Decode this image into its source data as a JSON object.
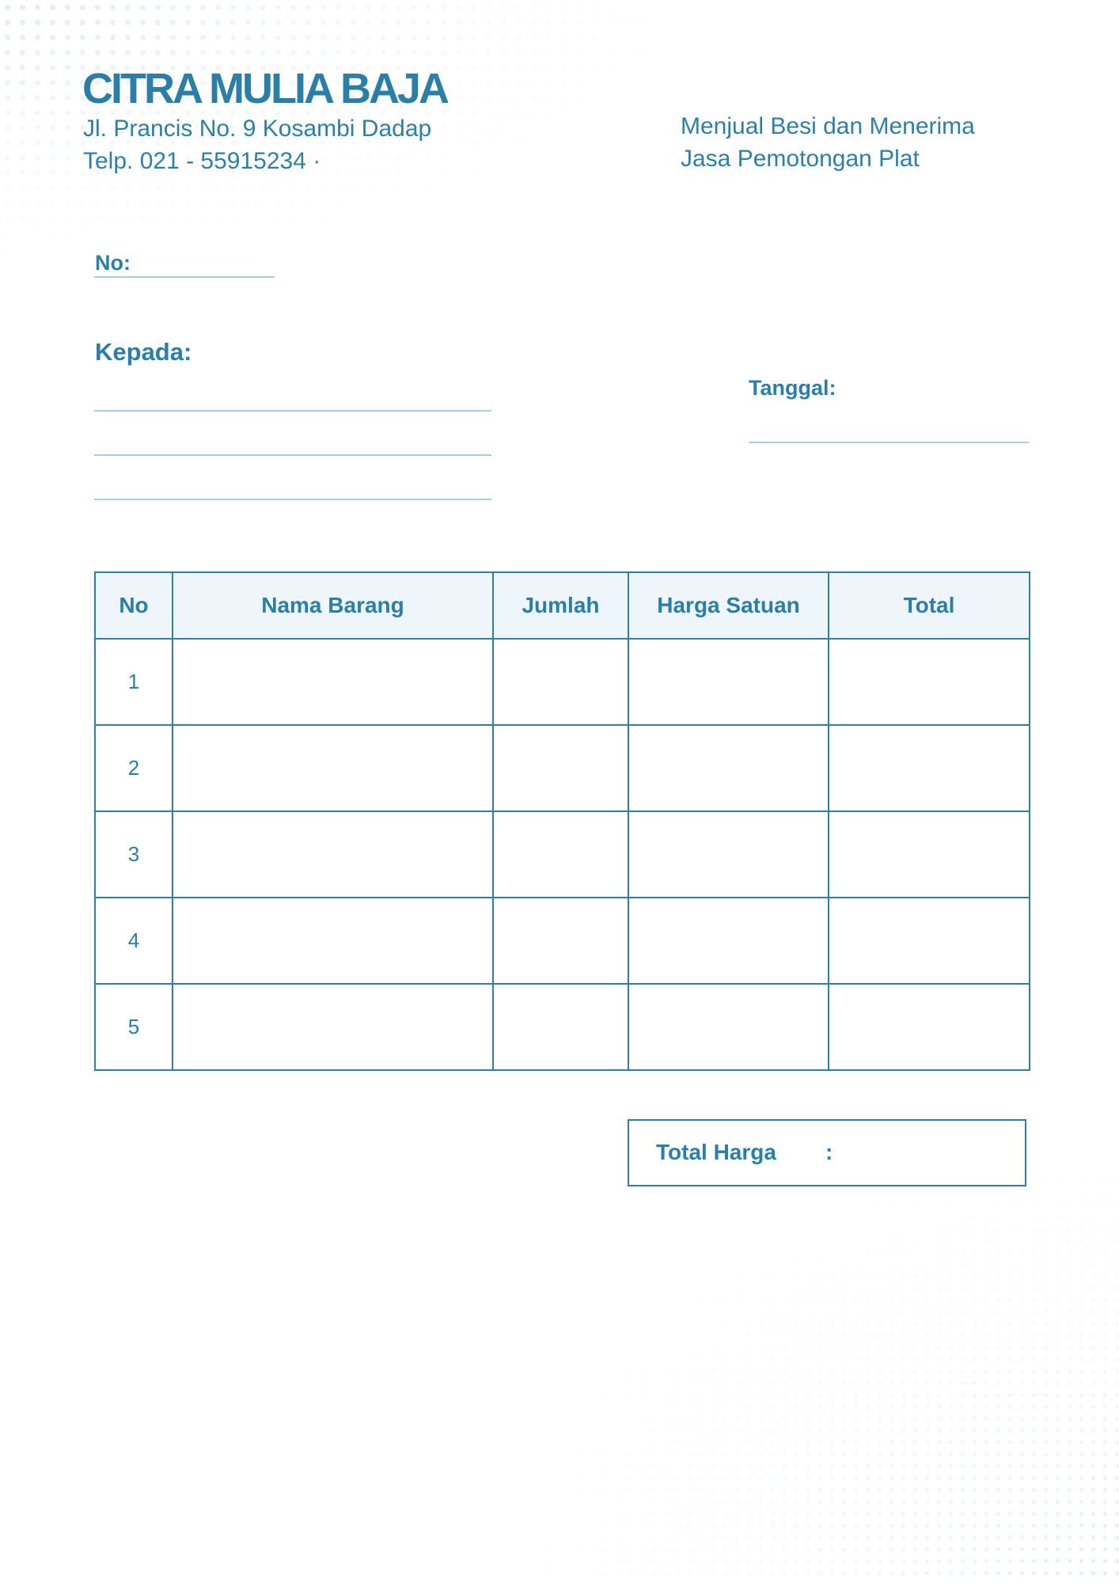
{
  "header": {
    "company_name": "CITRA MULIA BAJA",
    "address_line1": "Jl. Prancis No. 9 Kosambi Dadap",
    "address_line2": "Telp. 021 - 55915234 ·",
    "tagline_line1": "Menjual Besi dan Menerima",
    "tagline_line2": "Jasa Pemotongan Plat"
  },
  "form": {
    "no_label": "No:",
    "kepada_label": "Kepada:",
    "tanggal_label": "Tanggal:"
  },
  "table": {
    "headers": [
      "No",
      "Nama Barang",
      "Jumlah",
      "Harga Satuan",
      "Total"
    ],
    "rows": [
      {
        "no": "1",
        "nama": "",
        "jumlah": "",
        "harga": "",
        "total": ""
      },
      {
        "no": "2",
        "nama": "",
        "jumlah": "",
        "harga": "",
        "total": ""
      },
      {
        "no": "3",
        "nama": "",
        "jumlah": "",
        "harga": "",
        "total": ""
      },
      {
        "no": "4",
        "nama": "",
        "jumlah": "",
        "harga": "",
        "total": ""
      },
      {
        "no": "5",
        "nama": "",
        "jumlah": "",
        "harga": "",
        "total": ""
      }
    ]
  },
  "summary": {
    "total_label": "Total Harga",
    "separator": ":",
    "total_value": ""
  },
  "colors": {
    "primary": "#2a7ea8",
    "header_fill": "#eef6fc",
    "rule": "#a9cde0"
  }
}
